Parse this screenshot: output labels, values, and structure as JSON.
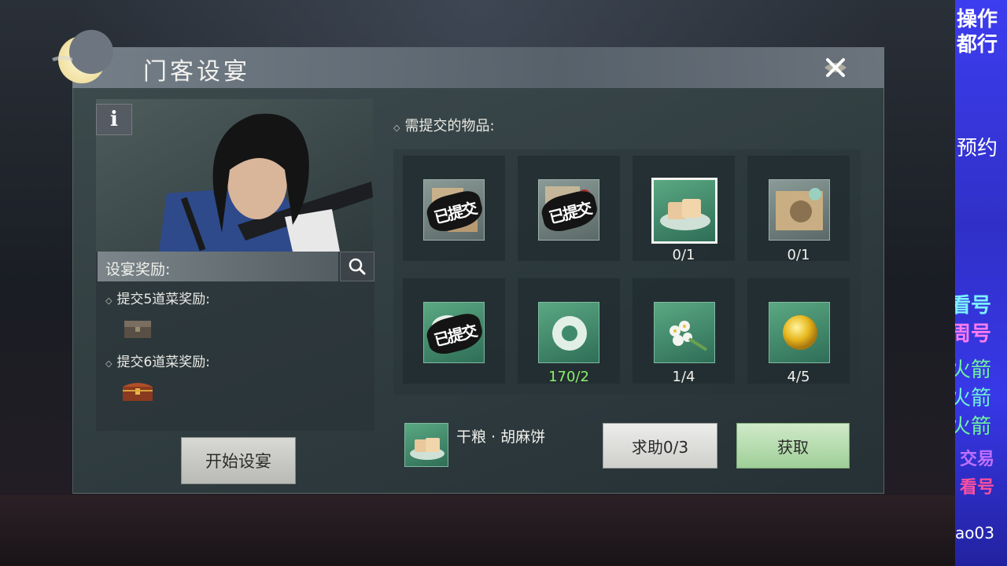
{
  "dialog": {
    "title": "门客设宴",
    "info_label": "i"
  },
  "rewards": {
    "header": "设宴奖励:",
    "tier1_label": "提交5道菜奖励:",
    "tier2_label": "提交6道菜奖励:",
    "start_button": "开始设宴"
  },
  "required": {
    "label": "需提交的物品:",
    "submitted_stamp": "已提交",
    "items": [
      {
        "icon": "pastry-plate-icon",
        "status": "submitted",
        "count": ""
      },
      {
        "icon": "pastry-plate-icon",
        "status": "submitted",
        "count": ""
      },
      {
        "icon": "sesame-cake-icon",
        "status": "selected",
        "count": "0/1"
      },
      {
        "icon": "scroll-bowl-icon",
        "status": "pending",
        "count": "0/1"
      },
      {
        "icon": "jade-plate-icon",
        "status": "submitted",
        "count": ""
      },
      {
        "icon": "jade-ring-icon",
        "status": "pending",
        "count": "170/2"
      },
      {
        "icon": "white-flowers-icon",
        "status": "pending",
        "count": "1/4"
      },
      {
        "icon": "gold-orb-icon",
        "status": "pending",
        "count": "4/5"
      }
    ]
  },
  "selected_item": {
    "name": "干粮 · 胡麻饼",
    "help_button": "求助0/3",
    "get_button": "获取"
  },
  "sidebar": {
    "lines": [
      "操作",
      "都行",
      "预约",
      "看号",
      "周号",
      "火箭",
      "火箭",
      "火箭",
      "交易",
      "看号",
      "ao03"
    ]
  },
  "colors": {
    "count_green": "#8ef06a",
    "slot_green": "#3f8a6c"
  }
}
